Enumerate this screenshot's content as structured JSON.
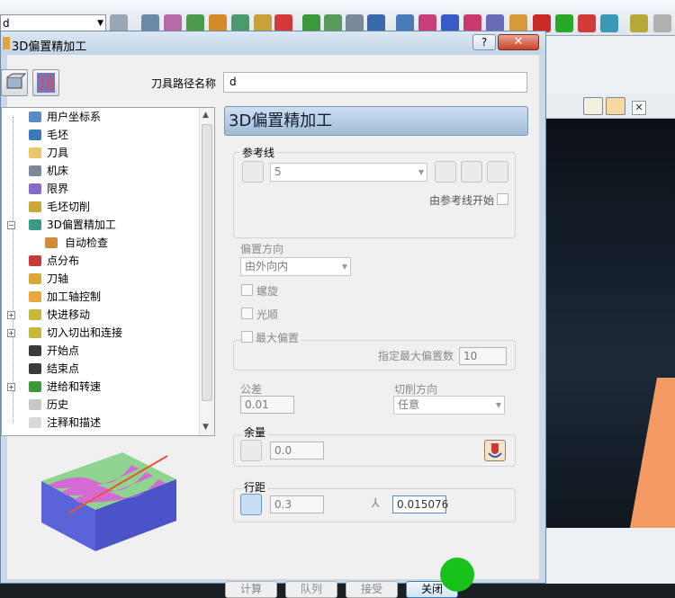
{
  "toolbar": {
    "combo_value": "d"
  },
  "dialog": {
    "title": "3D偏置精加工",
    "help_label": "?",
    "close_label": "✕",
    "name_label": "刀具路径名称",
    "name_value": "d"
  },
  "tree": {
    "items": [
      {
        "label": "用户坐标系"
      },
      {
        "label": "毛坯"
      },
      {
        "label": "刀具"
      },
      {
        "label": "机床"
      },
      {
        "label": "限界"
      },
      {
        "label": "毛坯切削"
      },
      {
        "label": "3D偏置精加工"
      },
      {
        "label": "自动检查"
      },
      {
        "label": "点分布"
      },
      {
        "label": "刀轴"
      },
      {
        "label": "加工轴控制"
      },
      {
        "label": "快进移动"
      },
      {
        "label": "切入切出和连接"
      },
      {
        "label": "开始点"
      },
      {
        "label": "结束点"
      },
      {
        "label": "进给和转速"
      },
      {
        "label": "历史"
      },
      {
        "label": "注释和描述"
      }
    ]
  },
  "panel": {
    "title": "3D偏置精加工",
    "ref_group": "参考线",
    "ref_value": "5",
    "ref_start_label": "由参考线开始",
    "offset_dir_label": "偏置方向",
    "offset_dir_value": "由外向内",
    "spiral_label": "螺旋",
    "smooth_label": "光顺",
    "max_offset_label": "最大偏置",
    "max_offset_count_label": "指定最大偏置数",
    "max_offset_count_value": "10",
    "tolerance_label": "公差",
    "tolerance_value": "0.01",
    "cut_dir_label": "切削方向",
    "cut_dir_value": "任意",
    "allowance_group": "余量",
    "allowance_value": "0.0",
    "stepover_group": "行距",
    "stepover_value": "0.3",
    "stepdown_value": "0.015076"
  },
  "buttons": {
    "calculate": "计算",
    "queue": "队列",
    "accept": "接受",
    "close": "关闭"
  }
}
